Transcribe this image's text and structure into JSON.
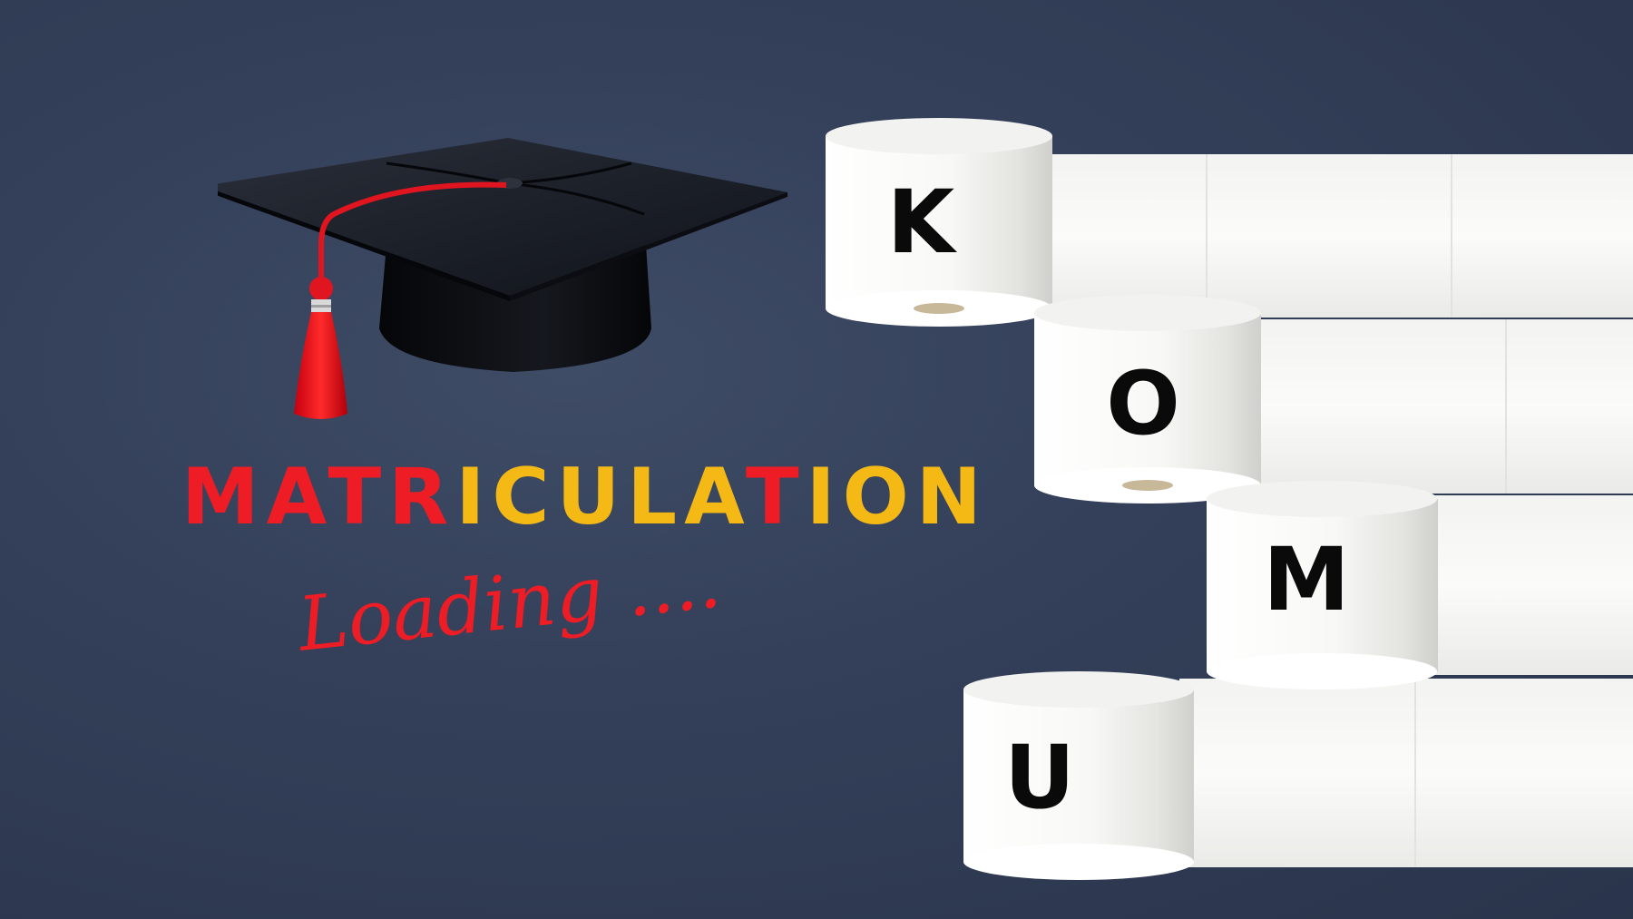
{
  "banner": {
    "title_parts": [
      "MATR",
      "ICULA",
      "T",
      "ION"
    ],
    "subtitle": "Loading ....",
    "roll_letters": [
      "K",
      "O",
      "M",
      "U"
    ]
  },
  "colors": {
    "background": "#34405a",
    "title_red": "#ee1c24",
    "title_yellow": "#f5b915",
    "cap": "#141820",
    "tassel": "#ee1c24",
    "paper": "#f7f7f5"
  },
  "icons": {
    "cap": "graduation-cap-icon",
    "rolls": "toilet-paper-roll-icon"
  }
}
